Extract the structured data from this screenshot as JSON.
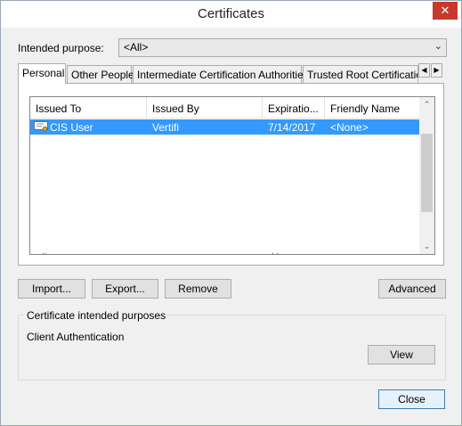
{
  "window": {
    "title": "Certificates"
  },
  "purpose": {
    "label": "Intended purpose:",
    "selected": "<All>"
  },
  "tabs": [
    {
      "label": "Personal"
    },
    {
      "label": "Other People"
    },
    {
      "label": "Intermediate Certification Authorities"
    },
    {
      "label": "Trusted Root Certification"
    }
  ],
  "table": {
    "columns": [
      "Issued To",
      "Issued By",
      "Expiratio...",
      "Friendly Name"
    ],
    "rows": [
      {
        "issued_to": "CIS User",
        "issued_by": "Vertifi",
        "expiration": "7/14/2017",
        "friendly_name": "<None>"
      }
    ]
  },
  "buttons": {
    "import": "Import...",
    "export": "Export...",
    "remove": "Remove",
    "advanced": "Advanced",
    "view": "View",
    "close": "Close"
  },
  "purposes_group": {
    "title": "Certificate intended purposes",
    "value": "Client Authentication"
  },
  "colors": {
    "selection": "#3399ff",
    "close_button": "#c7392b",
    "default_button_border": "#3c7fb1"
  },
  "icons": [
    "close-icon",
    "chevron-down-icon",
    "certificate-icon",
    "tab-scroll-left-icon",
    "tab-scroll-right-icon",
    "scroll-up-icon",
    "scroll-down-icon"
  ]
}
